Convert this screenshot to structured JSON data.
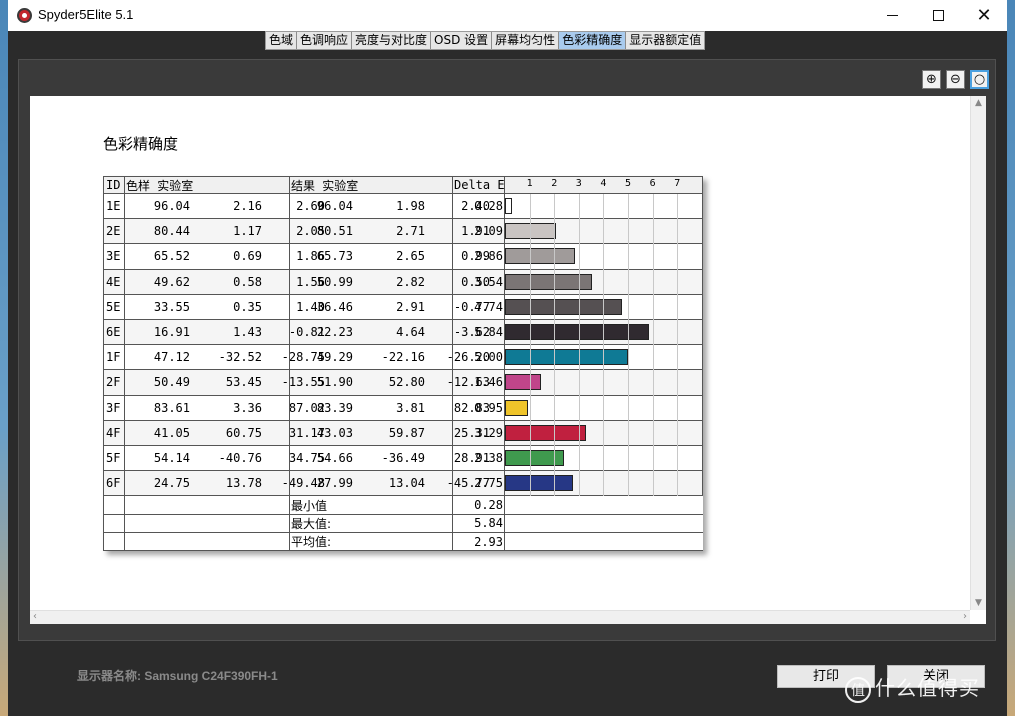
{
  "window": {
    "title": "Spyder5Elite 5.1",
    "minimize_icon": "minimize-icon",
    "maximize_icon": "maximize-icon",
    "close_icon": "close-icon"
  },
  "tabs": [
    {
      "label": "色域",
      "active": false
    },
    {
      "label": "色调响应",
      "active": false
    },
    {
      "label": "亮度与对比度",
      "active": false
    },
    {
      "label": "OSD 设置",
      "active": false
    },
    {
      "label": "屏幕均匀性",
      "active": false
    },
    {
      "label": "色彩精确度",
      "active": true
    },
    {
      "label": "显示器额定值",
      "active": false
    }
  ],
  "zoom_tools": [
    "zoom-in-icon",
    "zoom-out-icon",
    "zoom-fit-icon"
  ],
  "report": {
    "title": "色彩精确度",
    "headers": {
      "id": "ID",
      "sample": "色样 实验室",
      "result": "结果 实验室",
      "delta": "Delta E"
    },
    "ticks": [
      "1",
      "2",
      "3",
      "4",
      "5",
      "6",
      "7"
    ],
    "rows": [
      {
        "id": "1E",
        "s1": "96.04",
        "s2": "2.16",
        "s3": "2.60",
        "r1": "96.04",
        "r2": "1.98",
        "r3": "2.40",
        "de": "0.28",
        "value": 0.28,
        "color": "#ffffff"
      },
      {
        "id": "2E",
        "s1": "80.44",
        "s2": "1.17",
        "s3": "2.05",
        "r1": "80.51",
        "r2": "2.71",
        "r3": "1.91",
        "de": "2.09",
        "value": 2.09,
        "color": "#c9c4c2"
      },
      {
        "id": "3E",
        "s1": "65.52",
        "s2": "0.69",
        "s3": "1.86",
        "r1": "65.73",
        "r2": "2.65",
        "r3": "0.99",
        "de": "2.86",
        "value": 2.86,
        "color": "#a09b9a"
      },
      {
        "id": "4E",
        "s1": "49.62",
        "s2": "0.58",
        "s3": "1.56",
        "r1": "50.99",
        "r2": "2.82",
        "r3": "0.50",
        "de": "3.54",
        "value": 3.54,
        "color": "#7b7575"
      },
      {
        "id": "5E",
        "s1": "33.55",
        "s2": "0.35",
        "s3": "1.40",
        "r1": "36.46",
        "r2": "2.91",
        "r3": "-0.77",
        "de": "4.74",
        "value": 4.74,
        "color": "#555052"
      },
      {
        "id": "6E",
        "s1": "16.91",
        "s2": "1.43",
        "s3": "-0.81",
        "r1": "22.23",
        "r2": "4.64",
        "r3": "-3.62",
        "de": "5.84",
        "value": 5.84,
        "color": "#302a30"
      },
      {
        "id": "1F",
        "s1": "47.12",
        "s2": "-32.52",
        "s3": "-28.75",
        "r1": "49.29",
        "r2": "-22.16",
        "r3": "-26.20",
        "de": "5.00",
        "value": 5.0,
        "color": "#0f7a95"
      },
      {
        "id": "2F",
        "s1": "50.49",
        "s2": "53.45",
        "s3": "-13.55",
        "r1": "51.90",
        "r2": "52.80",
        "r3": "-12.63",
        "de": "1.46",
        "value": 1.46,
        "color": "#c0458a"
      },
      {
        "id": "3F",
        "s1": "83.61",
        "s2": "3.36",
        "s3": "87.02",
        "r1": "83.39",
        "r2": "3.81",
        "r3": "82.83",
        "de": "0.95",
        "value": 0.95,
        "color": "#efc42a"
      },
      {
        "id": "4F",
        "s1": "41.05",
        "s2": "60.75",
        "s3": "31.17",
        "r1": "43.03",
        "r2": "59.87",
        "r3": "25.31",
        "de": "3.29",
        "value": 3.29,
        "color": "#c0203f"
      },
      {
        "id": "5F",
        "s1": "54.14",
        "s2": "-40.76",
        "s3": "34.75",
        "r1": "54.66",
        "r2": "-36.49",
        "r3": "28.91",
        "de": "2.38",
        "value": 2.38,
        "color": "#3f9a4e"
      },
      {
        "id": "6F",
        "s1": "24.75",
        "s2": "13.78",
        "s3": "-49.48",
        "r1": "27.99",
        "r2": "13.04",
        "r3": "-45.77",
        "de": "2.75",
        "value": 2.75,
        "color": "#263785"
      }
    ],
    "stats": [
      {
        "label": "最小值",
        "value": "0.28"
      },
      {
        "label": "最大值:",
        "value": "5.84"
      },
      {
        "label": "平均值:",
        "value": "2.93"
      }
    ]
  },
  "chart_data": {
    "type": "bar",
    "categories": [
      "1E",
      "2E",
      "3E",
      "4E",
      "5E",
      "6E",
      "1F",
      "2F",
      "3F",
      "4F",
      "5F",
      "6F"
    ],
    "values": [
      0.28,
      2.09,
      2.86,
      3.54,
      4.74,
      5.84,
      5.0,
      1.46,
      0.95,
      3.29,
      2.38,
      2.75
    ],
    "colors": [
      "#ffffff",
      "#c9c4c2",
      "#a09b9a",
      "#7b7575",
      "#555052",
      "#302a30",
      "#0f7a95",
      "#c0458a",
      "#efc42a",
      "#c0203f",
      "#3f9a4e",
      "#263785"
    ],
    "xlim": [
      0,
      8
    ],
    "xticks": [
      1,
      2,
      3,
      4,
      5,
      6,
      7
    ],
    "orientation": "horizontal",
    "grid": true
  },
  "footer": {
    "display_name": "显示器名称: Samsung C24F390FH-1",
    "print_label": "打印",
    "close_label": "关闭"
  },
  "watermark": {
    "text": "什么值得买"
  }
}
